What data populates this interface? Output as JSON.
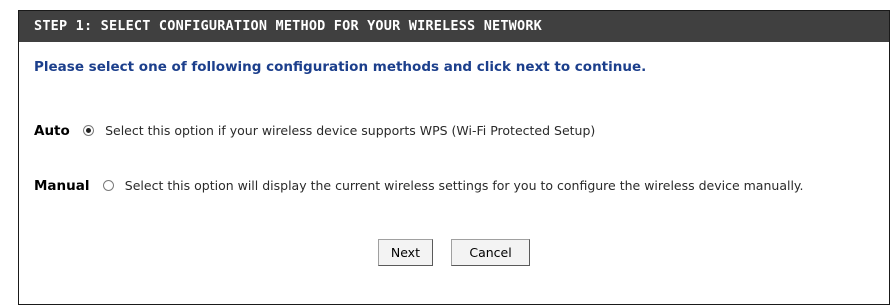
{
  "header": {
    "title": "STEP 1: SELECT CONFIGURATION METHOD FOR YOUR WIRELESS NETWORK"
  },
  "intro": "Please select one of following configuration methods and click next to continue.",
  "options": [
    {
      "label": "Auto",
      "selected": true,
      "description": "Select this option if your wireless device supports WPS (Wi-Fi Protected Setup)"
    },
    {
      "label": "Manual",
      "selected": false,
      "description": "Select this option will display the current wireless settings for you to configure the wireless device manually."
    }
  ],
  "buttons": {
    "next": "Next",
    "cancel": "Cancel"
  },
  "colors": {
    "header_bg": "#404040",
    "header_text": "#ffffff",
    "intro_text": "#1c3f8c"
  }
}
